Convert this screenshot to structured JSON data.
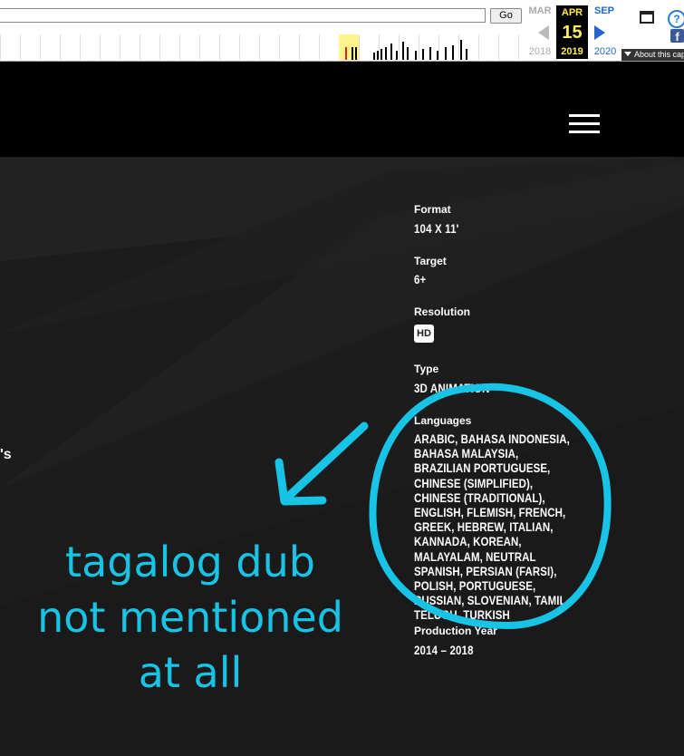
{
  "wayback": {
    "go_label": "Go",
    "url_value": "",
    "prev_month": "MAR",
    "current_month": "APR",
    "next_month": "SEP",
    "day": "15",
    "prev_year": "2018",
    "current_year": "2019",
    "next_year": "2020",
    "about_label": "About this capture",
    "help_glyph": "?",
    "facebook_glyph": "f"
  },
  "site": {
    "specs": {
      "format_label": "Format",
      "format_value": "104 X 11'",
      "target_label": "Target",
      "target_value": "6+",
      "resolution_label": "Resolution",
      "resolution_badge": "HD",
      "type_label": "Type",
      "type_value": "3D ANIMATION",
      "languages_label": "Languages",
      "languages_value": "ARABIC, BAHASA INDONESIA, BAHASA MALAYSIA, BRAZILIAN PORTUGUESE, CHINESE (SIMPLIFIED), CHINESE (TRADITIONAL), ENGLISH, FLEMISH, FRENCH, GREEK, HEBREW, ITALIAN, KANNADA, KOREAN, MALAYALAM, NEUTRAL SPANISH, PERSIAN (FARSI), POLISH, PORTUGUESE, RUSSIAN, SLOVENIAN, TAMIL, TELUGU, TURKISH",
      "production_label": "Production Year",
      "production_value": "2014 – 2018"
    },
    "edge_text": "'s"
  },
  "annotation": {
    "line1": "tagalog dub",
    "line2": "not mentioned",
    "line3": "at all",
    "color": "#17c4e6"
  }
}
